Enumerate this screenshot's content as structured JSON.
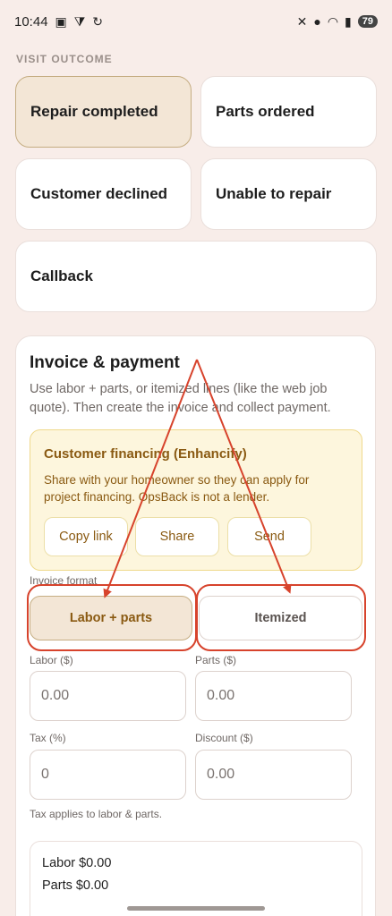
{
  "status_bar": {
    "time": "10:44",
    "battery": "79",
    "left_icons": [
      "screenshot-icon",
      "cast-icon",
      "sync-icon"
    ],
    "right_icons": [
      "mute-icon",
      "location-icon",
      "wifi-icon",
      "signal-icon",
      "battery-icon"
    ]
  },
  "visit_outcome": {
    "label": "VISIT OUTCOME",
    "options": [
      {
        "label": "Repair completed",
        "selected": true
      },
      {
        "label": "Parts ordered",
        "selected": false
      },
      {
        "label": "Customer declined",
        "selected": false
      },
      {
        "label": "Unable to repair",
        "selected": false
      },
      {
        "label": "Callback",
        "selected": false
      }
    ]
  },
  "invoice": {
    "title": "Invoice & payment",
    "description": "Use labor + parts, or itemized lines (like the web job quote). Then create the invoice and collect payment.",
    "financing": {
      "title": "Customer financing (Enhancify)",
      "description": "Share with your homeowner so they can apply for project financing. OpsBack is not a lender.",
      "buttons": [
        "Copy link",
        "Share",
        "Send"
      ]
    },
    "format_label": "Invoice format",
    "formats": [
      {
        "label": "Labor + parts",
        "selected": true
      },
      {
        "label": "Itemized",
        "selected": false
      }
    ],
    "fields": {
      "labor": {
        "label": "Labor ($)",
        "placeholder": "0.00"
      },
      "parts": {
        "label": "Parts ($)",
        "placeholder": "0.00"
      },
      "tax": {
        "label": "Tax (%)",
        "placeholder": "0"
      },
      "discount": {
        "label": "Discount ($)",
        "placeholder": "0.00"
      }
    },
    "tax_note": "Tax applies to labor & parts.",
    "summary": {
      "labor": "Labor $0.00",
      "parts": "Parts $0.00"
    }
  },
  "colors": {
    "background": "#f8ede9",
    "accent_selected": "#f3e6d6",
    "financing_text": "#8a5a12",
    "annotation_red": "#d7432c"
  }
}
